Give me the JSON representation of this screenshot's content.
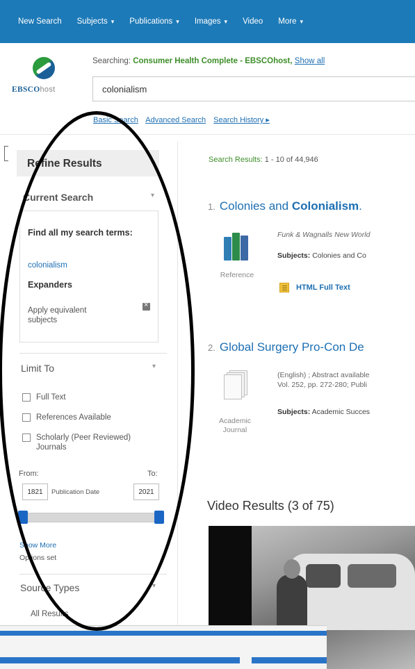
{
  "nav": {
    "items": [
      {
        "label": "New Search",
        "caret": false
      },
      {
        "label": "Subjects",
        "caret": true
      },
      {
        "label": "Publications",
        "caret": true
      },
      {
        "label": "Images",
        "caret": true
      },
      {
        "label": "Video",
        "caret": false
      },
      {
        "label": "More",
        "caret": true
      }
    ]
  },
  "header": {
    "logo_brand": "EBSCO",
    "logo_host": "host",
    "searching_prefix": "Searching:",
    "database": "Consumer Health Complete - EBSCOhost,",
    "show_all": "Show all",
    "query": "colonialism",
    "links": [
      "Basic Search",
      "Advanced Search",
      "Search History ▸"
    ]
  },
  "refine": {
    "title": "Refine Results",
    "current_search_title": "Current Search",
    "find_all_label": "Find all my search terms:",
    "term": "colonialism",
    "expanders_label": "Expanders",
    "apply_equivalent": "Apply equivalent subjects",
    "limit_to_title": "Limit To",
    "checkboxes": [
      "Full Text",
      "References Available",
      "Scholarly (Peer Reviewed) Journals"
    ],
    "from_label": "From:",
    "to_label": "To:",
    "from_year": "1821",
    "to_year": "2021",
    "pubdate_label": "Publication Date",
    "show_more": "Show More",
    "options_set": "Options set",
    "source_types_title": "Source Types",
    "all_results": "All Results"
  },
  "results": {
    "count_label": "Search Results:",
    "count_value": "1 - 10 of 44,946",
    "items": [
      {
        "num": "1.",
        "title_plain": "Colonies and ",
        "title_bold": "Colonialism",
        "title_tail": ".",
        "meta": "Funk & Wagnalls New World",
        "subjects_label": "Subjects:",
        "subjects_value": "Colonies and Co",
        "type": "Reference",
        "full_text": "HTML Full Text"
      },
      {
        "num": "2.",
        "title_plain": "Global Surgery Pro-Con De",
        "meta_line1": "(English) ; Abstract available",
        "meta_line2": "Vol. 252, pp. 272-280; Publi",
        "subjects_label": "Subjects:",
        "subjects_value": "Academic Succes",
        "type_line1": "Academic",
        "type_line2": "Journal"
      }
    ],
    "video_heading": "Video Results (3 of 75)"
  },
  "colors": {
    "nav_bg": "#1d7ab8",
    "link": "#1d6fb3",
    "database_green": "#3e8e2a",
    "slider_blue": "#1a66c4",
    "annotation": "#000000"
  }
}
